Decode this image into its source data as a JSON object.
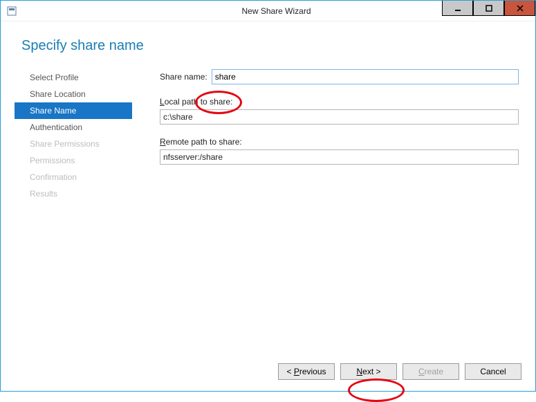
{
  "window": {
    "title": "New Share Wizard"
  },
  "heading": "Specify share name",
  "steps": [
    {
      "label": "Select Profile",
      "state": "normal"
    },
    {
      "label": "Share Location",
      "state": "normal"
    },
    {
      "label": "Share Name",
      "state": "selected"
    },
    {
      "label": "Authentication",
      "state": "normal"
    },
    {
      "label": "Share Permissions",
      "state": "disabled"
    },
    {
      "label": "Permissions",
      "state": "disabled"
    },
    {
      "label": "Confirmation",
      "state": "disabled"
    },
    {
      "label": "Results",
      "state": "disabled"
    }
  ],
  "form": {
    "shareName": {
      "label": "Share name:",
      "value": "share"
    },
    "localPath": {
      "label_pre": "L",
      "label_rest": "ocal path to share:",
      "value": "c:\\share"
    },
    "remotePath": {
      "label_pre": "R",
      "label_rest": "emote path to share:",
      "value": "nfsserver:/share"
    }
  },
  "buttons": {
    "previous_pre": "< ",
    "previous_u": "P",
    "previous_rest": "revious",
    "next_u": "N",
    "next_rest": "ext >",
    "create_u": "C",
    "create_rest": "reate",
    "cancel": "Cancel"
  }
}
